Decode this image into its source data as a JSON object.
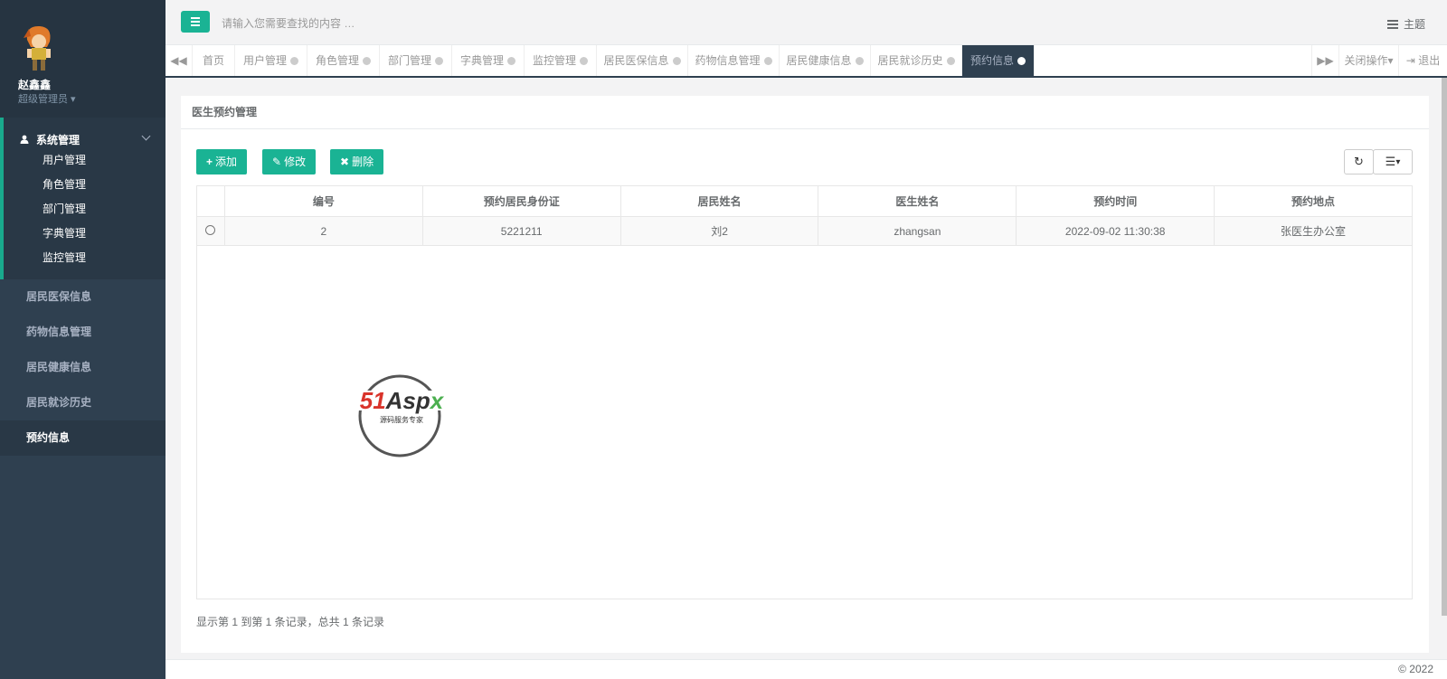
{
  "sidebar": {
    "user_name": "赵鑫鑫",
    "user_role": "超级管理员",
    "group": {
      "label": "系统管理",
      "items": [
        "用户管理",
        "角色管理",
        "部门管理",
        "字典管理",
        "监控管理"
      ]
    },
    "items": [
      "居民医保信息",
      "药物信息管理",
      "居民健康信息",
      "居民就诊历史",
      "预约信息"
    ],
    "active_item": "预约信息"
  },
  "topbar": {
    "search_placeholder": "请输入您需要查找的内容 …",
    "theme_label": "主题"
  },
  "tabs": {
    "items": [
      "首页",
      "用户管理",
      "角色管理",
      "部门管理",
      "字典管理",
      "监控管理",
      "居民医保信息",
      "药物信息管理",
      "居民健康信息",
      "居民就诊历史",
      "预约信息"
    ],
    "active": "预约信息",
    "close_ops": "关闭操作",
    "logout": "退出"
  },
  "panel": {
    "title": "医生预约管理",
    "buttons": {
      "add": "添加",
      "edit": "修改",
      "delete": "删除"
    },
    "columns": [
      "编号",
      "预约居民身份证",
      "居民姓名",
      "医生姓名",
      "预约时间",
      "预约地点"
    ],
    "rows": [
      [
        "2",
        "5221211",
        "刘2",
        "zhangsan",
        "2022-09-02 11:30:38",
        "张医生办公室"
      ]
    ],
    "pager_text": "显示第 1 到第 1 条记录，总共 1 条记录"
  },
  "watermark": {
    "brand": "51Aspx",
    "tagline": "源码服务专家"
  },
  "footer": {
    "copyright": "© 2022"
  },
  "colors": {
    "accent": "#1ab394",
    "sidebar": "#2f4050",
    "sidebar_dark": "#293846"
  }
}
